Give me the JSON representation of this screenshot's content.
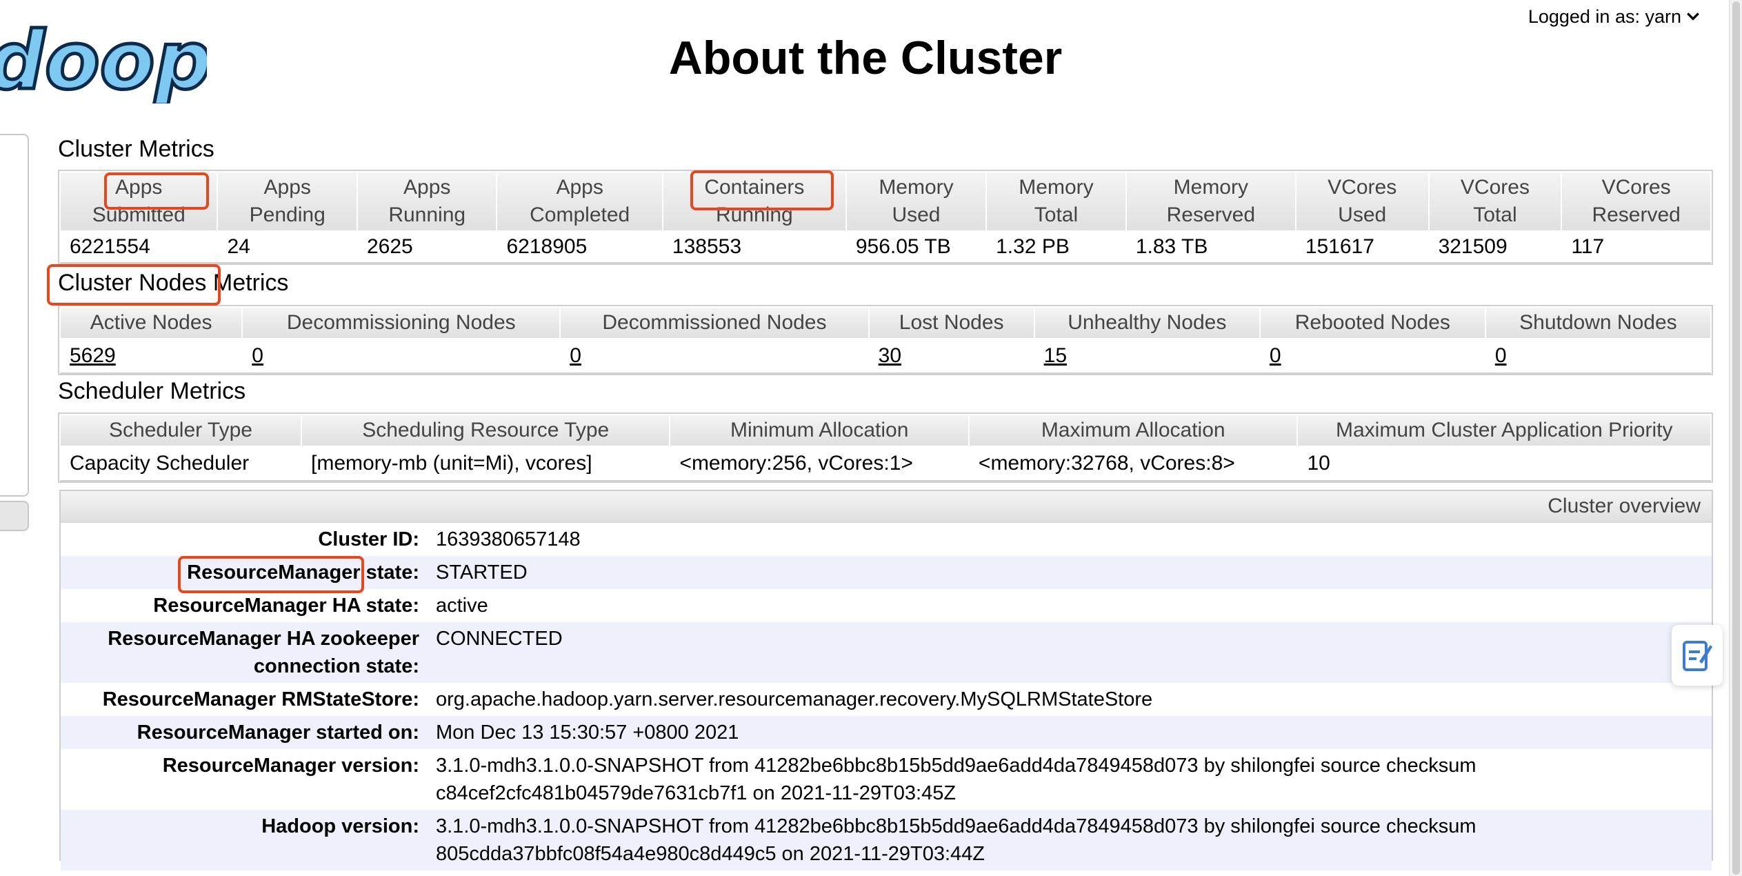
{
  "header": {
    "logo_text": "doop",
    "title": "About the Cluster",
    "login": "Logged in as: yarn"
  },
  "icons": {
    "login_menu": "chevron-down-icon",
    "feedback": "edit-note-icon"
  },
  "colors": {
    "highlight": "#e8461c",
    "logo_blue": "#7ec9f2",
    "alt_row": "#eef0fb"
  },
  "cluster_metrics": {
    "title": "Cluster Metrics",
    "headers": [
      [
        "Apps",
        "Submitted"
      ],
      [
        "Apps",
        "Pending"
      ],
      [
        "Apps",
        "Running"
      ],
      [
        "Apps",
        "Completed"
      ],
      [
        "Containers",
        "Running"
      ],
      [
        "Memory",
        "Used"
      ],
      [
        "Memory",
        "Total"
      ],
      [
        "Memory",
        "Reserved"
      ],
      [
        "VCores",
        "Used"
      ],
      [
        "VCores",
        "Total"
      ],
      [
        "VCores",
        "Reserved"
      ]
    ],
    "values": [
      "6221554",
      "24",
      "2625",
      "6218905",
      "138553",
      "956.05 TB",
      "1.32 PB",
      "1.83 TB",
      "151617",
      "321509",
      "117"
    ]
  },
  "nodes_metrics": {
    "title_part1": "Cluster Nodes",
    "title_part2": " Metrics",
    "headers": [
      "Active Nodes",
      "Decommissioning Nodes",
      "Decommissioned Nodes",
      "Lost Nodes",
      "Unhealthy Nodes",
      "Rebooted Nodes",
      "Shutdown Nodes"
    ],
    "values": [
      "5629",
      "0",
      "0",
      "30",
      "15",
      "0",
      "0"
    ]
  },
  "scheduler_metrics": {
    "title": "Scheduler Metrics",
    "headers": [
      "Scheduler Type",
      "Scheduling Resource Type",
      "Minimum Allocation",
      "Maximum Allocation",
      "Maximum Cluster Application Priority"
    ],
    "values": [
      "Capacity Scheduler",
      "[memory-mb (unit=Mi), vcores]",
      "<memory:256, vCores:1>",
      "<memory:32768, vCores:8>",
      "10"
    ]
  },
  "overview": {
    "header": "Cluster overview",
    "rows": [
      {
        "label": "Cluster ID:",
        "value": "1639380657148"
      },
      {
        "label_prefix": "ResourceManager",
        "label_suffix": " state:",
        "value": "STARTED"
      },
      {
        "label": "ResourceManager HA state:",
        "value": "active"
      },
      {
        "label": "ResourceManager HA zookeeper connection state:",
        "value": "CONNECTED"
      },
      {
        "label": "ResourceManager RMStateStore:",
        "value": "org.apache.hadoop.yarn.server.resourcemanager.recovery.MySQLRMStateStore"
      },
      {
        "label": "ResourceManager started on:",
        "value": "Mon Dec 13 15:30:57 +0800 2021"
      },
      {
        "label": "ResourceManager version:",
        "value": "3.1.0-mdh3.1.0.0-SNAPSHOT from 41282be6bbc8b15b5dd9ae6add4da7849458d073 by shilongfei source checksum c84cef2cfc481b04579de7631cb7f1 on 2021-11-29T03:45Z"
      },
      {
        "label": "Hadoop version:",
        "value": "3.1.0-mdh3.1.0.0-SNAPSHOT from 41282be6bbc8b15b5dd9ae6add4da7849458d073 by shilongfei source checksum 805cdda37bbfc08f54a4e980c8d449c5 on 2021-11-29T03:44Z"
      }
    ]
  }
}
